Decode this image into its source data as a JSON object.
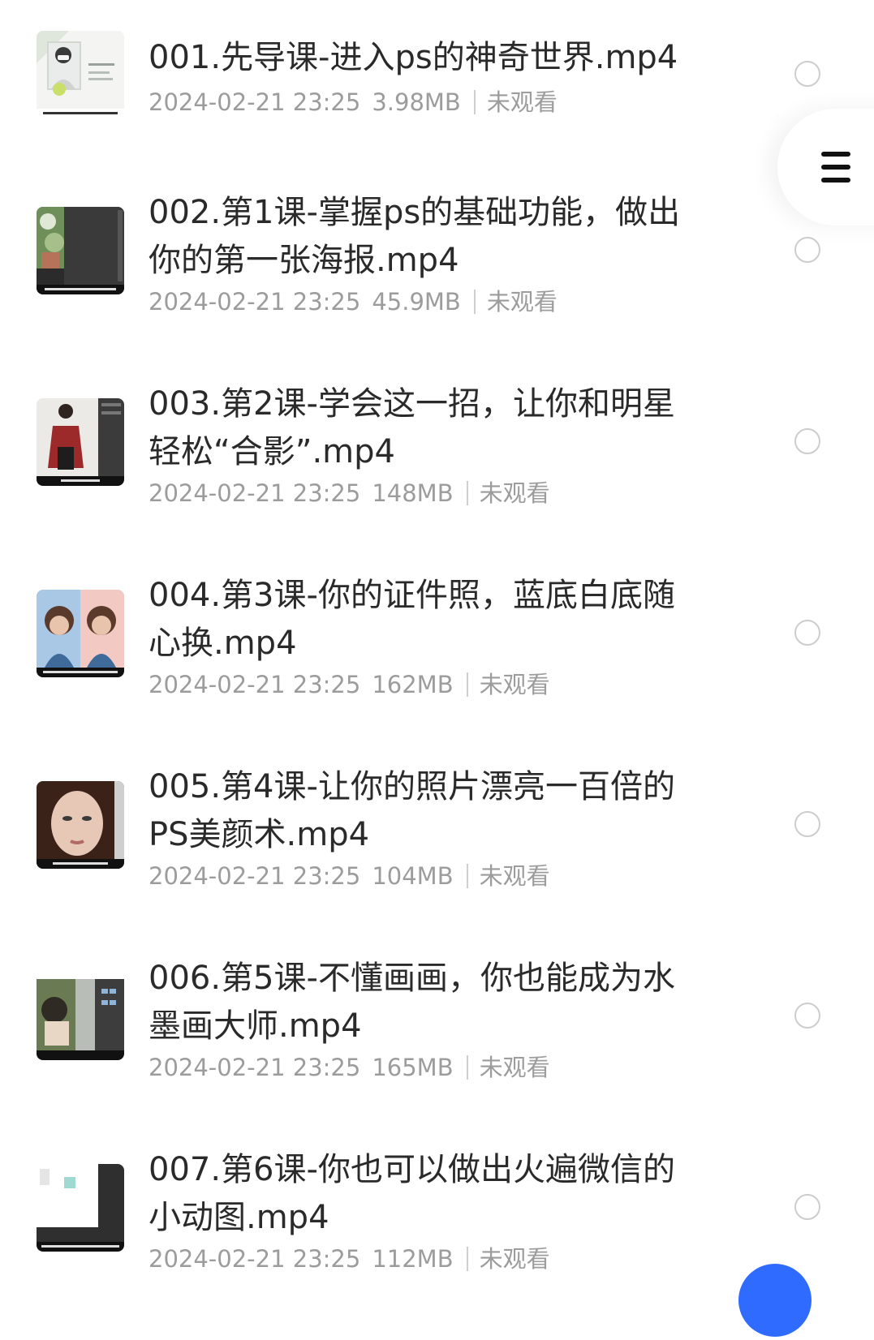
{
  "files": [
    {
      "title": "001.先导课-进入ps的神奇世界.mp4",
      "date": "2024-02-21 23:25",
      "size": "3.98MB",
      "status": "未观看"
    },
    {
      "title": "002.第1课-掌握ps的基础功能，做出你的第一张海报.mp4",
      "date": "2024-02-21 23:25",
      "size": "45.9MB",
      "status": "未观看"
    },
    {
      "title": "003.第2课-学会这一招，让你和明星轻松“合影”.mp4",
      "date": "2024-02-21 23:25",
      "size": "148MB",
      "status": "未观看"
    },
    {
      "title": "004.第3课-你的证件照，蓝底白底随心换.mp4",
      "date": "2024-02-21 23:25",
      "size": "162MB",
      "status": "未观看"
    },
    {
      "title": "005.第4课-让你的照片漂亮一百倍的PS美颜术.mp4",
      "date": "2024-02-21 23:25",
      "size": "104MB",
      "status": "未观看"
    },
    {
      "title": "006.第5课-不懂画画，你也能成为水墨画大师.mp4",
      "date": "2024-02-21 23:25",
      "size": "165MB",
      "status": "未观看"
    },
    {
      "title": "007.第6课-你也可以做出火遍微信的小动图.mp4",
      "date": "2024-02-21 23:25",
      "size": "112MB",
      "status": "未观看"
    }
  ],
  "thumb_icons": [
    "video-thumbnail-icon"
  ],
  "menu_icon": "hamburger-menu-icon",
  "colors": {
    "title_text": "#2a2a2a",
    "meta_text": "#9c9c9c",
    "radio_border": "#cdcdcd",
    "accent_blue": "#2f6bff"
  }
}
